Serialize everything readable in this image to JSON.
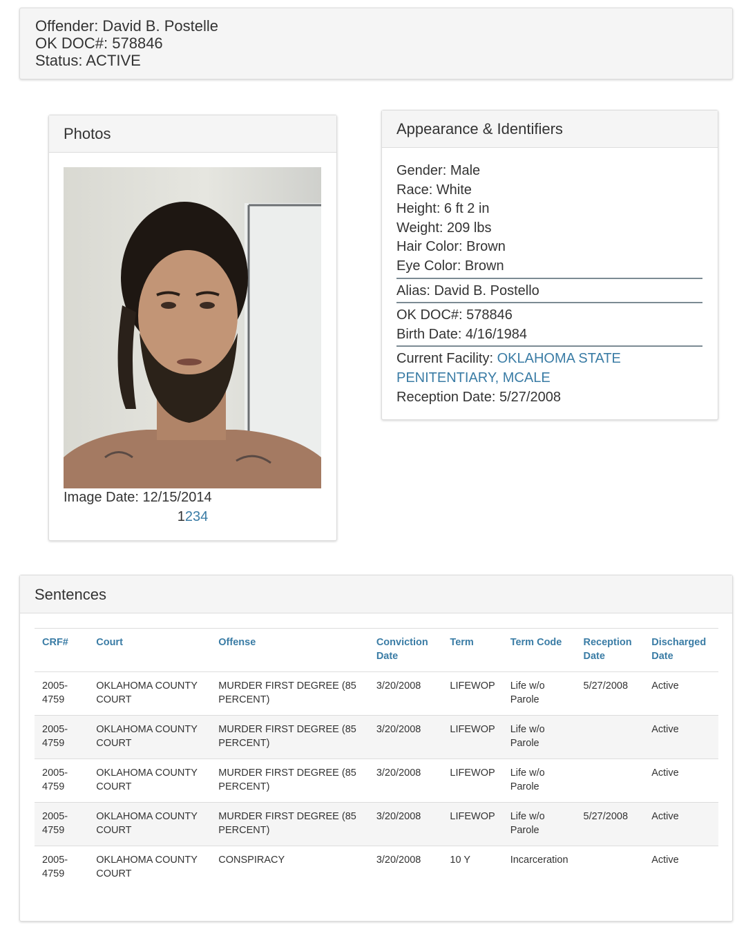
{
  "offender": {
    "name_line": "Offender: David B. Postelle",
    "doc_line": "OK DOC#: 578846",
    "status_line": "Status: ACTIVE"
  },
  "photos": {
    "title": "Photos",
    "image_date": "Image Date: 12/15/2014",
    "pages": [
      "1",
      "2",
      "3",
      "4"
    ],
    "current_page": "1"
  },
  "appearance": {
    "title": "Appearance & Identifiers",
    "gender": "Gender: Male",
    "race": "Race: White",
    "height": "Height: 6 ft 2 in",
    "weight": "Weight: 209 lbs",
    "hair": "Hair Color: Brown",
    "eye": "Eye Color: Brown",
    "alias": "Alias: David B. Postello",
    "doc": "OK DOC#: 578846",
    "birth": "Birth Date: 4/16/1984",
    "facility_label": "Current Facility: ",
    "facility_link": "OKLAHOMA STATE PENITENTIARY, MCALE",
    "reception": "Reception Date: 5/27/2008"
  },
  "sentences": {
    "title": "Sentences",
    "columns": [
      "CRF#",
      "Court",
      "Offense",
      "Conviction Date",
      "Term",
      "Term Code",
      "Reception Date",
      "Discharged Date"
    ],
    "rows": [
      [
        "2005-4759",
        "OKLAHOMA COUNTY COURT",
        "MURDER FIRST DEGREE (85 PERCENT)",
        "3/20/2008",
        "LIFEWOP",
        "Life w/o Parole",
        "5/27/2008",
        "Active"
      ],
      [
        "2005-4759",
        "OKLAHOMA COUNTY COURT",
        "MURDER FIRST DEGREE (85 PERCENT)",
        "3/20/2008",
        "LIFEWOP",
        "Life w/o Parole",
        "",
        "Active"
      ],
      [
        "2005-4759",
        "OKLAHOMA COUNTY COURT",
        "MURDER FIRST DEGREE (85 PERCENT)",
        "3/20/2008",
        "LIFEWOP",
        "Life w/o Parole",
        "",
        "Active"
      ],
      [
        "2005-4759",
        "OKLAHOMA COUNTY COURT",
        "MURDER FIRST DEGREE (85 PERCENT)",
        "3/20/2008",
        "LIFEWOP",
        "Life w/o Parole",
        "5/27/2008",
        "Active"
      ],
      [
        "2005-4759",
        "OKLAHOMA COUNTY COURT",
        "CONSPIRACY",
        "3/20/2008",
        "10 Y",
        "Incarceration",
        "",
        "Active"
      ]
    ]
  },
  "colors": {
    "link": "#3a7ca5",
    "panel_heading_bg": "#f5f5f5",
    "border": "#dcdcdc",
    "divider": "#7b8a93"
  }
}
